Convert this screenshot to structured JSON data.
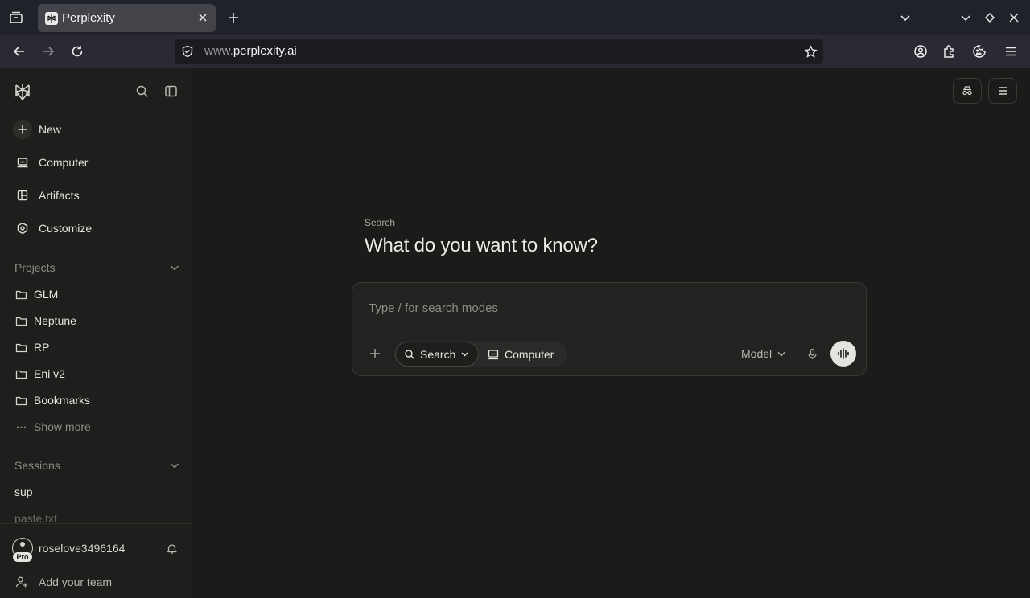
{
  "browser": {
    "tab_title": "Perplexity",
    "url_prefix": "www.",
    "url_domain": "perplexity.ai"
  },
  "sidebar": {
    "nav": [
      {
        "label": "New",
        "icon": "plus-icon"
      },
      {
        "label": "Computer",
        "icon": "computer-icon"
      },
      {
        "label": "Artifacts",
        "icon": "artifacts-icon"
      },
      {
        "label": "Customize",
        "icon": "hexagon-icon"
      }
    ],
    "projects_title": "Projects",
    "projects": [
      "GLM",
      "Neptune",
      "RP",
      "Eni v2",
      "Bookmarks"
    ],
    "show_more": "Show more",
    "sessions_title": "Sessions",
    "sessions": [
      "sup",
      "paste.txt"
    ],
    "user": {
      "name": "roselove3496164",
      "badge": "Pro"
    },
    "add_team": "Add your team"
  },
  "main": {
    "mode_label": "Search",
    "headline": "What do you want to know?",
    "composer": {
      "placeholder": "Type / for search modes",
      "search_label": "Search",
      "computer_label": "Computer",
      "model_label": "Model"
    }
  },
  "colors": {
    "background": "#1c1b1a",
    "sidebar": "#1f1e1c",
    "browser_tabbar": "#1f2229",
    "browser_navbar": "#2b2a33",
    "voice_button": "#e6e4df"
  }
}
